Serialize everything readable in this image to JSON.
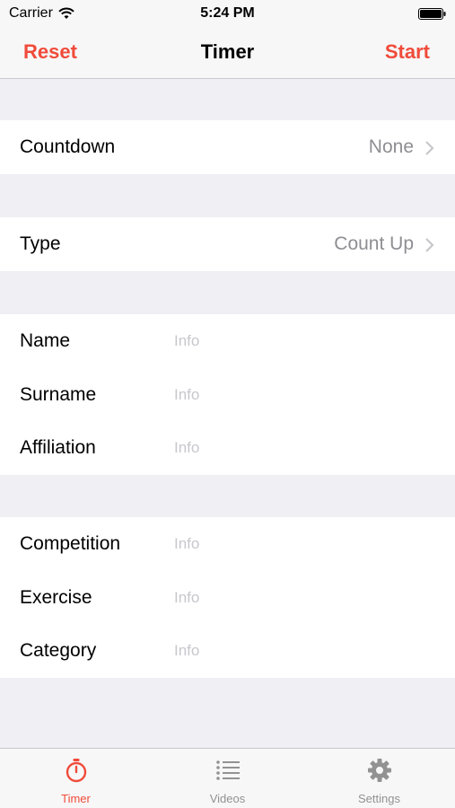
{
  "status_bar": {
    "carrier": "Carrier",
    "time": "5:24 PM"
  },
  "nav": {
    "left_label": "Reset",
    "title": "Timer",
    "right_label": "Start"
  },
  "settings": {
    "countdown": {
      "label": "Countdown",
      "value": "None"
    },
    "type": {
      "label": "Type",
      "value": "Count Up"
    }
  },
  "athlete_fields": [
    {
      "label": "Name",
      "placeholder": "Info",
      "value": ""
    },
    {
      "label": "Surname",
      "placeholder": "Info",
      "value": ""
    },
    {
      "label": "Affiliation",
      "placeholder": "Info",
      "value": ""
    }
  ],
  "event_fields": [
    {
      "label": "Competition",
      "placeholder": "Info",
      "value": ""
    },
    {
      "label": "Exercise",
      "placeholder": "Info",
      "value": ""
    },
    {
      "label": "Category",
      "placeholder": "Info",
      "value": ""
    }
  ],
  "tabs": [
    {
      "label": "Timer",
      "icon": "stopwatch-icon",
      "active": true
    },
    {
      "label": "Videos",
      "icon": "list-icon",
      "active": false
    },
    {
      "label": "Settings",
      "icon": "gear-icon",
      "active": false
    }
  ],
  "colors": {
    "accent": "#f04b3a",
    "inactive": "#929292",
    "background": "#efeff4",
    "placeholder": "#c7c7cd"
  }
}
